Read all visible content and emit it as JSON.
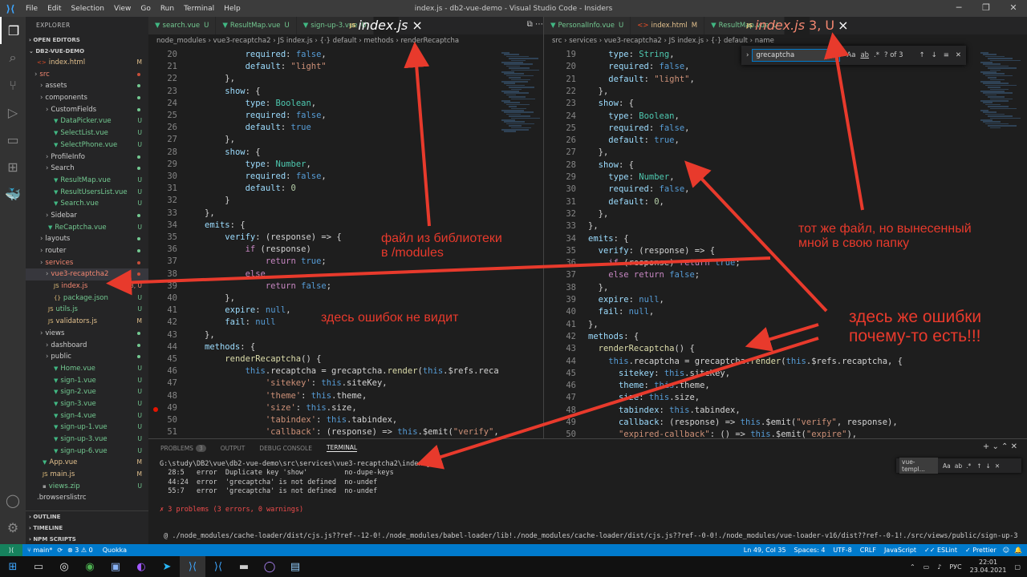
{
  "titlebar": {
    "menus": [
      "File",
      "Edit",
      "Selection",
      "View",
      "Go",
      "Run",
      "Terminal",
      "Help"
    ],
    "title": "index.js - db2-vue-demo - Visual Studio Code - Insiders"
  },
  "sidebar": {
    "header": "EXPLORER",
    "sec_open": "OPEN EDITORS",
    "sec_project": "DB2-VUE-DEMO",
    "items": [
      {
        "label": "index.html",
        "indent": 1,
        "badge": "M",
        "bc": "m"
      },
      {
        "label": "src",
        "indent": 1,
        "dot": "e"
      },
      {
        "label": "assets",
        "indent": 2,
        "dot": "u"
      },
      {
        "label": "components",
        "indent": 2,
        "dot": "u"
      },
      {
        "label": "CustomFields",
        "indent": 3,
        "dot": "u"
      },
      {
        "label": "DataPicker.vue",
        "indent": 4,
        "badge": "U",
        "bc": "u"
      },
      {
        "label": "SelectList.vue",
        "indent": 4,
        "badge": "U",
        "bc": "u"
      },
      {
        "label": "SelectPhone.vue",
        "indent": 4,
        "badge": "U",
        "bc": "u"
      },
      {
        "label": "ProfileInfo",
        "indent": 3,
        "dot": "u"
      },
      {
        "label": "Search",
        "indent": 3,
        "dot": "u"
      },
      {
        "label": "ResultMap.vue",
        "indent": 4,
        "badge": "U",
        "bc": "u"
      },
      {
        "label": "ResultUsersList.vue",
        "indent": 4,
        "badge": "U",
        "bc": "u"
      },
      {
        "label": "Search.vue",
        "indent": 4,
        "badge": "U",
        "bc": "u"
      },
      {
        "label": "Sidebar",
        "indent": 3,
        "dot": "u"
      },
      {
        "label": "ReCaptcha.vue",
        "indent": 3,
        "badge": "U",
        "bc": "u"
      },
      {
        "label": "layouts",
        "indent": 2,
        "dot": "u"
      },
      {
        "label": "router",
        "indent": 2,
        "dot": "u"
      },
      {
        "label": "services",
        "indent": 2,
        "dot": "e"
      },
      {
        "label": "vue3-recaptcha2",
        "indent": 3,
        "dot": "e",
        "sel": true
      },
      {
        "label": "index.js",
        "indent": 4,
        "badge": "3, U",
        "bc": "e"
      },
      {
        "label": "package.json",
        "indent": 4,
        "badge": "U",
        "bc": "u"
      },
      {
        "label": "utils.js",
        "indent": 3,
        "badge": "U",
        "bc": "u"
      },
      {
        "label": "validators.js",
        "indent": 3,
        "badge": "M",
        "bc": "m"
      },
      {
        "label": "views",
        "indent": 2,
        "dot": "u"
      },
      {
        "label": "dashboard",
        "indent": 3,
        "dot": "u"
      },
      {
        "label": "public",
        "indent": 3,
        "dot": "u"
      },
      {
        "label": "Home.vue",
        "indent": 4,
        "badge": "U",
        "bc": "u"
      },
      {
        "label": "sign-1.vue",
        "indent": 4,
        "badge": "U",
        "bc": "u"
      },
      {
        "label": "sign-2.vue",
        "indent": 4,
        "badge": "U",
        "bc": "u"
      },
      {
        "label": "sign-3.vue",
        "indent": 4,
        "badge": "U",
        "bc": "u"
      },
      {
        "label": "sign-4.vue",
        "indent": 4,
        "badge": "U",
        "bc": "u"
      },
      {
        "label": "sign-up-1.vue",
        "indent": 4,
        "badge": "U",
        "bc": "u"
      },
      {
        "label": "sign-up-3.vue",
        "indent": 4,
        "badge": "U",
        "bc": "u"
      },
      {
        "label": "sign-up-6.vue",
        "indent": 4,
        "badge": "U",
        "bc": "u"
      },
      {
        "label": "App.vue",
        "indent": 2,
        "badge": "M",
        "bc": "m"
      },
      {
        "label": "main.js",
        "indent": 2,
        "badge": "M",
        "bc": "m"
      },
      {
        "label": "views.zip",
        "indent": 2,
        "badge": "U",
        "bc": "u"
      },
      {
        "label": ".browserslistrc",
        "indent": 1
      }
    ],
    "sec_outline": "OUTLINE",
    "sec_timeline": "TIMELINE",
    "sec_npm": "NPM SCRIPTS"
  },
  "left_editor": {
    "tabs": [
      {
        "label": "search.vue",
        "suffix": "U",
        "type": "vue"
      },
      {
        "label": "ResultMap.vue",
        "suffix": "U",
        "type": "vue"
      },
      {
        "label": "sign-up-3.vue",
        "suffix": "U",
        "type": "vue"
      },
      {
        "label": "index.js",
        "suffix": "×",
        "type": "js",
        "active": true
      }
    ],
    "breadcrumb": "node_modules › vue3-recaptcha2 › JS index.js › {⋅} default › methods › renderRecaptcha",
    "lines": [
      {
        "n": "20",
        "text": "        required: false,"
      },
      {
        "n": "21",
        "text": "        default: \"light\""
      },
      {
        "n": "22",
        "text": "    },"
      },
      {
        "n": "23",
        "text": "    show: {"
      },
      {
        "n": "24",
        "text": "        type: Boolean,"
      },
      {
        "n": "25",
        "text": "        required: false,"
      },
      {
        "n": "26",
        "text": "        default: true"
      },
      {
        "n": "27",
        "text": "    },"
      },
      {
        "n": "28",
        "text": "    show: {"
      },
      {
        "n": "29",
        "text": "        type: Number,"
      },
      {
        "n": "30",
        "text": "        required: false,"
      },
      {
        "n": "31",
        "text": "        default: 0"
      },
      {
        "n": "32",
        "text": "    }"
      },
      {
        "n": "33",
        "text": "},"
      },
      {
        "n": "34",
        "text": "emits: {"
      },
      {
        "n": "35",
        "text": "    verify: (response) => {"
      },
      {
        "n": "36",
        "text": "        if (response)"
      },
      {
        "n": "37",
        "text": "            return true;"
      },
      {
        "n": "38",
        "text": "        else"
      },
      {
        "n": "39",
        "text": "            return false;"
      },
      {
        "n": "40",
        "text": "    },"
      },
      {
        "n": "41",
        "text": "    expire: null,"
      },
      {
        "n": "42",
        "text": "    fail: null"
      },
      {
        "n": "43",
        "text": "},"
      },
      {
        "n": "44",
        "text": "methods: {"
      },
      {
        "n": "45",
        "text": "    renderRecaptcha() {"
      },
      {
        "n": "46",
        "text": "        this.recaptcha = grecaptcha.render(this.$refs.recap"
      },
      {
        "n": "47",
        "text": "            'sitekey': this.siteKey,"
      },
      {
        "n": "48",
        "text": "            'theme': this.theme,"
      },
      {
        "n": "49",
        "text": "            'size': this.size,"
      },
      {
        "n": "50",
        "text": "            'tabindex': this.tabindex,"
      },
      {
        "n": "51",
        "text": "            'callback': (response) => this.$emit(\"verify\","
      }
    ]
  },
  "right_editor": {
    "tabs": [
      {
        "label": "PersonalInfo.vue",
        "suffix": "U",
        "type": "vue"
      },
      {
        "label": "index.html",
        "suffix": "M",
        "type": "html"
      },
      {
        "label": "ResultMap.vue",
        "suffix": "U",
        "type": "vue"
      },
      {
        "label": "index.js",
        "suffix": "3, U",
        "type": "js",
        "active": true
      }
    ],
    "breadcrumb": "src › services › vue3-recaptcha2 › JS index.js › {⋅} default › name",
    "lines": [
      {
        "n": "19",
        "text": "    type: String,"
      },
      {
        "n": "20",
        "text": "    required: false,"
      },
      {
        "n": "21",
        "text": "    default: \"light\","
      },
      {
        "n": "22",
        "text": "  },"
      },
      {
        "n": "23",
        "text": "  show: {"
      },
      {
        "n": "24",
        "text": "    type: Boolean,"
      },
      {
        "n": "25",
        "text": "    required: false,"
      },
      {
        "n": "26",
        "text": "    default: true,"
      },
      {
        "n": "27",
        "text": "  },"
      },
      {
        "n": "28",
        "text": "  show: {"
      },
      {
        "n": "29",
        "text": "    type: Number,"
      },
      {
        "n": "30",
        "text": "    required: false,"
      },
      {
        "n": "31",
        "text": "    default: 0,"
      },
      {
        "n": "32",
        "text": "  },"
      },
      {
        "n": "33",
        "text": "},"
      },
      {
        "n": "34",
        "text": "emits: {"
      },
      {
        "n": "35",
        "text": "  verify: (response) => {"
      },
      {
        "n": "36",
        "text": "    if (response) return true;"
      },
      {
        "n": "37",
        "text": "    else return false;"
      },
      {
        "n": "38",
        "text": "  },"
      },
      {
        "n": "39",
        "text": "  expire: null,"
      },
      {
        "n": "40",
        "text": "  fail: null,"
      },
      {
        "n": "41",
        "text": "},"
      },
      {
        "n": "42",
        "text": "methods: {"
      },
      {
        "n": "43",
        "text": "  renderRecaptcha() {"
      },
      {
        "n": "44",
        "text": "    this.recaptcha = grecaptcha.render(this.$refs.recaptcha, {"
      },
      {
        "n": "45",
        "text": "      sitekey: this.siteKey,"
      },
      {
        "n": "46",
        "text": "      theme: this.theme,"
      },
      {
        "n": "47",
        "text": "      size: this.size,"
      },
      {
        "n": "48",
        "text": "      tabindex: this.tabindex,"
      },
      {
        "n": "49",
        "text": "      callback: (response) => this.$emit(\"verify\", response),"
      },
      {
        "n": "50",
        "text": "      \"expired-callback\": () => this.$emit(\"expire\"),"
      }
    ],
    "find": {
      "value": "grecaptcha",
      "count": "? of 3"
    }
  },
  "panel": {
    "tabs": [
      "PROBLEMS",
      "OUTPUT",
      "DEBUG CONSOLE",
      "TERMINAL"
    ],
    "problems_count": "3",
    "term_find": "vue-templ...",
    "terminal": [
      "G:\\study\\DB2\\vue\\db2-vue-demo\\src\\services\\vue3-recaptcha2\\index.js",
      "  28:5   error  Duplicate key 'show'         no-dupe-keys",
      "  44:24  error  'grecaptcha' is not defined  no-undef",
      "  55:7   error  'grecaptcha' is not defined  no-undef",
      "",
      "✗ 3 problems (3 errors, 0 warnings)",
      "",
      "",
      " @ ./node_modules/cache-loader/dist/cjs.js??ref--12-0!./node_modules/babel-loader/lib!./node_modules/cache-loader/dist/cjs.js??ref--0-0!./node_modules/vue-loader-v16/dist??ref--0-1!./src/views/public/sign-up-3.vue?vue&type"
    ]
  },
  "statusbar": {
    "branch": "main*",
    "problems": "⊗ 3 ⚠ 0",
    "quokka": "Quokka",
    "position": "Ln 49, Col 35",
    "spaces": "Spaces: 4",
    "encoding": "UTF-8",
    "eol": "CRLF",
    "language": "JavaScript",
    "eslint": "✓✓ ESLint",
    "prettier": "✓ Prettier"
  },
  "taskbar": {
    "lang": "РУС",
    "time": "22:01",
    "date": "23.04.2021"
  },
  "annotations": {
    "lib_file": "файл из библиотеки\nв /modules",
    "no_errors": "здесь ошибок не видит",
    "same_file": "тот же файл, но вынесенный\nмной в свою папку",
    "has_errors": "здесь же ошибки\nпочему-то есть!!!"
  },
  "colors": {
    "accent": "#007acc",
    "annotation": "#e83a2c"
  }
}
